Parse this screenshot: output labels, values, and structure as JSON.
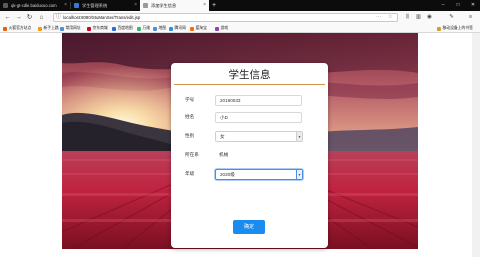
{
  "browser": {
    "tabs": [
      {
        "label": "qk-gt-cdle.baiduxuo.com",
        "active": false,
        "favicon_color": "#5a5a5a"
      },
      {
        "label": "学生管理系统",
        "active": false,
        "favicon_color": "#3a78d6"
      },
      {
        "label": "添加学生信息",
        "active": true,
        "favicon_color": "#9a9a9a"
      }
    ],
    "new_tab_glyph": "+",
    "window_controls": [
      "–",
      "□",
      "✕"
    ],
    "url": "localhost:8080/StuManSer/Trans/edit.jsp",
    "nav_glyphs": {
      "back": "←",
      "forward": "→",
      "reload": "↻",
      "home": "⌂",
      "info": "ⓘ",
      "more": "···",
      "star": "☆",
      "menu": "≡"
    },
    "bookmarks": [
      {
        "label": "火狐官方站点",
        "color": "#e66000"
      },
      {
        "label": "新手上路",
        "color": "#ff9500"
      },
      {
        "label": "常用网址",
        "color": "#4a90d9"
      },
      {
        "label": "京东商城",
        "color": "#d0021b"
      },
      {
        "label": "百度地图",
        "color": "#2d6ad8"
      },
      {
        "label": "万维",
        "color": "#3cb371"
      },
      {
        "label": "地图",
        "color": "#4a90d9"
      },
      {
        "label": "腾讯网",
        "color": "#2f8cde"
      },
      {
        "label": "爱淘宝",
        "color": "#ff6a00"
      },
      {
        "label": "游戏",
        "color": "#8e44ad"
      }
    ],
    "bookmarks_right": "移动设备上的书签"
  },
  "form": {
    "title": "学生信息",
    "fields": {
      "id": {
        "label": "学号",
        "value": "20190033"
      },
      "name": {
        "label": "姓名",
        "value": "小D"
      },
      "gender": {
        "label": "性别",
        "value": "女"
      },
      "college": {
        "label": "所在系",
        "value": "机械"
      },
      "grade": {
        "label": "年级",
        "value": "2020级"
      }
    },
    "submit_label": "确定",
    "accent_color": "#1a8cf0"
  }
}
